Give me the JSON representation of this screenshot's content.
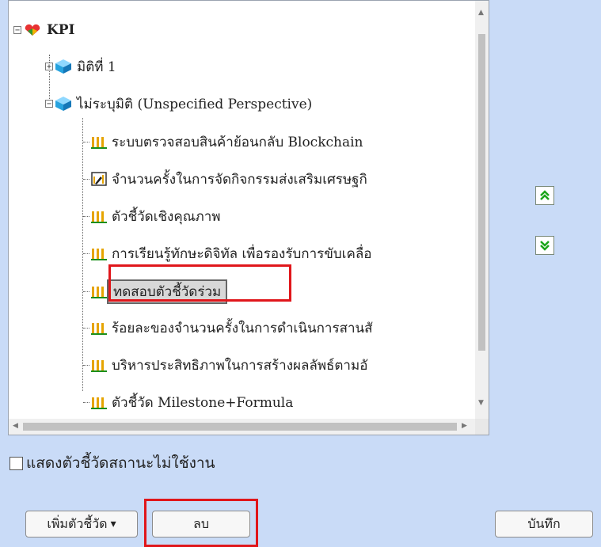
{
  "tree": {
    "root": {
      "label": "KPI",
      "icon": "kpi-hearts-icon",
      "expander": "⊟"
    },
    "perspective_1": {
      "label": "มิติที่ 1",
      "icon": "cube-icon",
      "expander": "+"
    },
    "unspecified": {
      "label": "ไม่ระบุมิติ (Unspecified Perspective)",
      "icon": "cube-icon",
      "expander": "−"
    },
    "kpis": [
      {
        "label": "ระบบตรวจสอบสินค้าย้อนกลับ Blockchain",
        "icon": "bar-chart-icon"
      },
      {
        "label": "จำนวนครั้งในการจัดกิจกรรมส่งเสริมเศรษฐกิ",
        "icon": "edit-chart-icon"
      },
      {
        "label": "ตัวชี้วัดเชิงคุณภาพ",
        "icon": "bar-chart-icon"
      },
      {
        "label": "การเรียนรู้ทักษะดิจิทัล เพื่อรองรับการขับเคลื่อ",
        "icon": "bar-chart-icon"
      },
      {
        "label": "ทดสอบตัวชี้วัดร่วม",
        "icon": "bar-chart-icon",
        "selected": true
      },
      {
        "label": "ร้อยละของจำนวนครั้งในการดำเนินการสานสั",
        "icon": "bar-chart-icon"
      },
      {
        "label": "บริหารประสิทธิภาพในการสร้างผลลัพธ์ตามอั",
        "icon": "bar-chart-icon"
      },
      {
        "label": "ตัวชี้วัด Milestone+Formula",
        "icon": "bar-chart-icon"
      }
    ]
  },
  "show_inactive_label": "แสดงตัวชี้วัดสถานะไม่ใช้งาน",
  "buttons": {
    "add_kpi": "เพิ่มตัวชี้วัด",
    "add_kpi_caret": "▾",
    "delete": "ลบ",
    "save": "บันทึก"
  },
  "move_buttons": {
    "up": "move-up-icon",
    "down": "move-down-icon"
  },
  "colors": {
    "background": "#c9dbf7",
    "highlight": "#e0161b",
    "move_icon": "#1aa51a"
  }
}
